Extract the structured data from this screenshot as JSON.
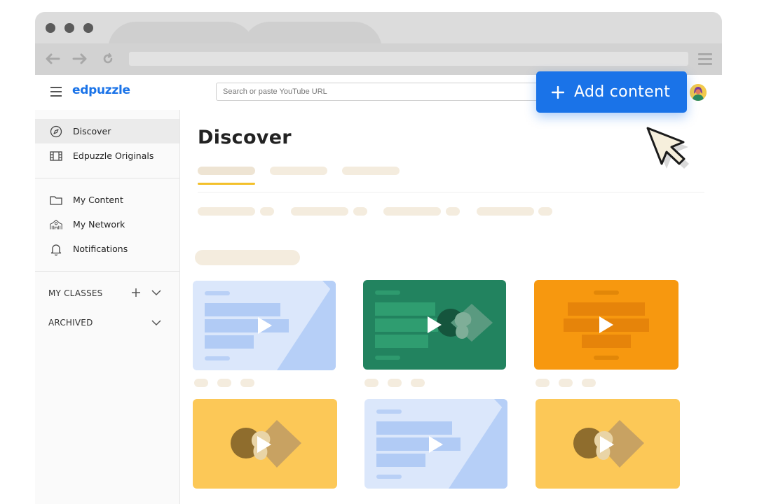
{
  "app": {
    "logo_text": "edpuzzle"
  },
  "search": {
    "placeholder": "Search or paste YouTube URL"
  },
  "add_button": {
    "label": "Add content",
    "icon": "plus-icon",
    "color": "#1a73e8"
  },
  "sidebar": {
    "items": [
      {
        "label": "Discover",
        "icon": "compass-icon",
        "active": true
      },
      {
        "label": "Edpuzzle Originals",
        "icon": "film-icon",
        "active": false
      },
      {
        "label": "My Content",
        "icon": "folder-icon",
        "active": false
      },
      {
        "label": "My Network",
        "icon": "school-icon",
        "active": false
      },
      {
        "label": "Notifications",
        "icon": "bell-icon",
        "active": false
      }
    ],
    "my_classes": "MY CLASSES",
    "archived": "ARCHIVED"
  },
  "main": {
    "title": "Discover"
  },
  "colors": {
    "accent_blue": "#1a73e8",
    "tab_underline": "#f3c02b",
    "card_green": "#22835f",
    "card_orange": "#f7980f",
    "card_yellow": "#fcc857",
    "card_light_blue": "#dbe7fb"
  }
}
